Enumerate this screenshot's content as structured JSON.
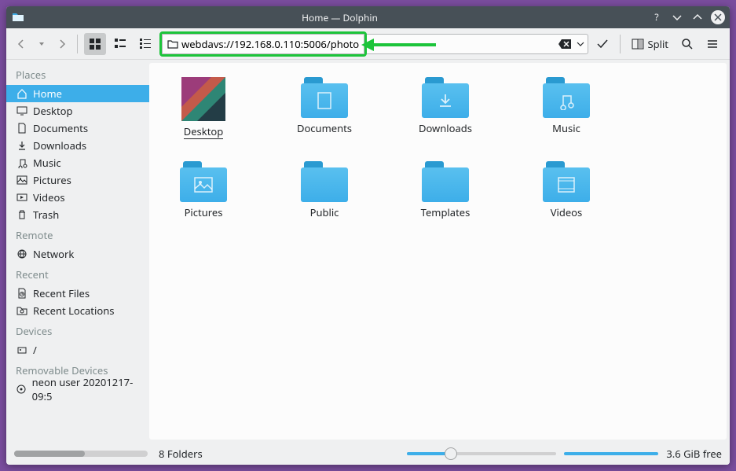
{
  "window": {
    "title": "Home — Dolphin"
  },
  "toolbar": {
    "address": "webdavs://192.168.0.110:5006/photo",
    "split_label": "Split"
  },
  "sidebar": {
    "sections": [
      {
        "header": "Places",
        "items": [
          {
            "icon": "home-icon",
            "label": "Home",
            "selected": true
          },
          {
            "icon": "desktop-icon",
            "label": "Desktop",
            "selected": false
          },
          {
            "icon": "documents-icon",
            "label": "Documents",
            "selected": false
          },
          {
            "icon": "downloads-icon",
            "label": "Downloads",
            "selected": false
          },
          {
            "icon": "music-icon",
            "label": "Music",
            "selected": false
          },
          {
            "icon": "pictures-icon",
            "label": "Pictures",
            "selected": false
          },
          {
            "icon": "videos-icon",
            "label": "Videos",
            "selected": false
          },
          {
            "icon": "trash-icon",
            "label": "Trash",
            "selected": false
          }
        ]
      },
      {
        "header": "Remote",
        "items": [
          {
            "icon": "network-icon",
            "label": "Network",
            "selected": false
          }
        ]
      },
      {
        "header": "Recent",
        "items": [
          {
            "icon": "recent-files-icon",
            "label": "Recent Files",
            "selected": false
          },
          {
            "icon": "recent-locations-icon",
            "label": "Recent Locations",
            "selected": false
          }
        ]
      },
      {
        "header": "Devices",
        "items": [
          {
            "icon": "root-icon",
            "label": "/",
            "selected": false
          }
        ]
      },
      {
        "header": "Removable Devices",
        "items": [
          {
            "icon": "removable-icon",
            "label": "neon user 20201217-09:5",
            "selected": false
          }
        ]
      }
    ]
  },
  "content": {
    "items": [
      {
        "label": "Desktop",
        "type": "desktop",
        "selected": true
      },
      {
        "label": "Documents",
        "type": "folder",
        "inner": "document"
      },
      {
        "label": "Downloads",
        "type": "folder",
        "inner": "download"
      },
      {
        "label": "Music",
        "type": "folder",
        "inner": "music"
      },
      {
        "label": "Pictures",
        "type": "folder",
        "inner": "picture"
      },
      {
        "label": "Public",
        "type": "folder",
        "inner": ""
      },
      {
        "label": "Templates",
        "type": "folder",
        "inner": ""
      },
      {
        "label": "Videos",
        "type": "folder",
        "inner": "video"
      }
    ]
  },
  "status": {
    "summary": "8 Folders",
    "free_space": "3.6 GiB free"
  }
}
